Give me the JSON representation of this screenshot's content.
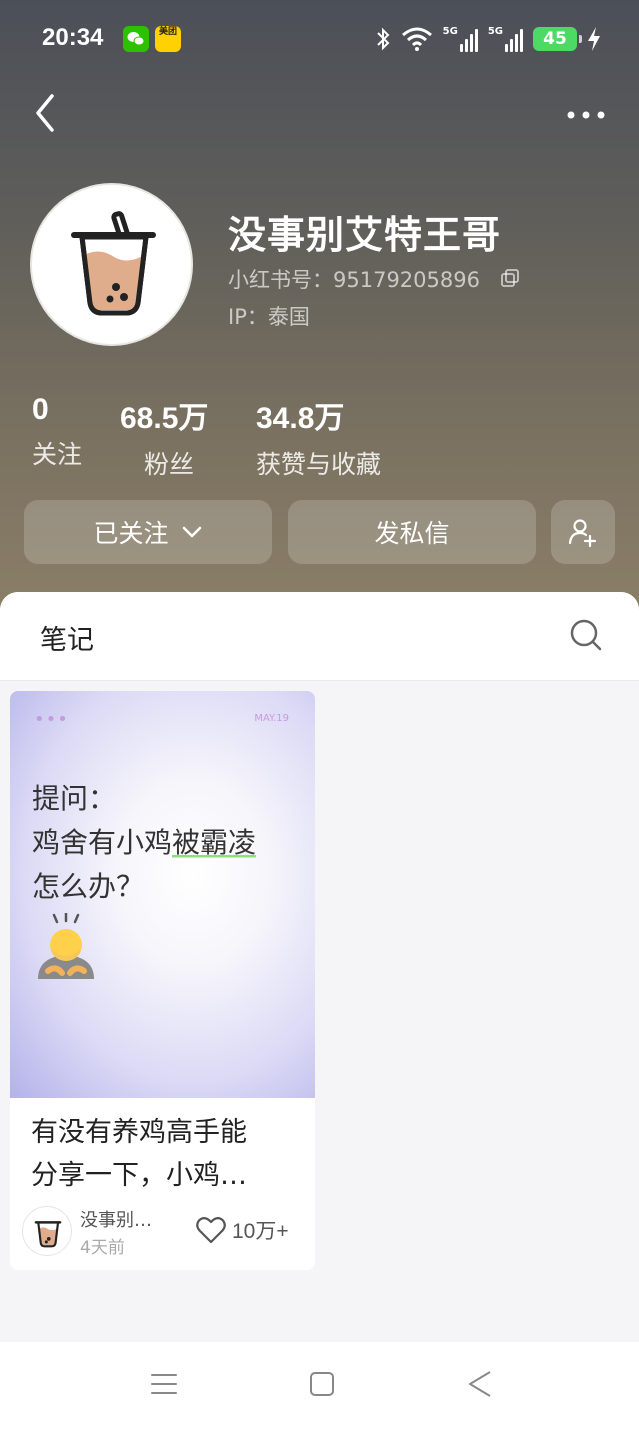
{
  "status_bar": {
    "time": "20:34",
    "apps": [
      "wechat-icon",
      "meituan-icon"
    ],
    "meituan_label": "美团",
    "signal_1": "5G",
    "signal_2": "5G",
    "battery": "45"
  },
  "profile": {
    "username": "没事别艾特王哥",
    "red_id": "小红书号：95179205896",
    "ip": "IP：泰国",
    "stats": [
      {
        "value": "0",
        "label": "关注"
      },
      {
        "value": "68.5万",
        "label": "粉丝"
      },
      {
        "value": "34.8万",
        "label": "获赞与收藏"
      }
    ],
    "follow_button": "已关注",
    "message_button": "发私信"
  },
  "tabs": {
    "notes": "笔记"
  },
  "note_card": {
    "cover_dots": "•••",
    "cover_date": "MAY.19",
    "cover_line_1": "提问：",
    "cover_line_2_a": "鸡舍有小鸡",
    "cover_line_2_b": "被霸凌",
    "cover_line_3": "怎么办？",
    "title_line_1": "有没有养鸡高手能",
    "title_line_2": "分享一下，小鸡…",
    "author": "没事别…",
    "time_ago": "4天前",
    "likes": "10万+"
  },
  "colors": {
    "header_top": "#4b4f58",
    "header_bottom": "#8b7f68",
    "highlight_underline": "#8de07a",
    "cover_accent": "#c59be0",
    "battery": "#4cd964"
  }
}
